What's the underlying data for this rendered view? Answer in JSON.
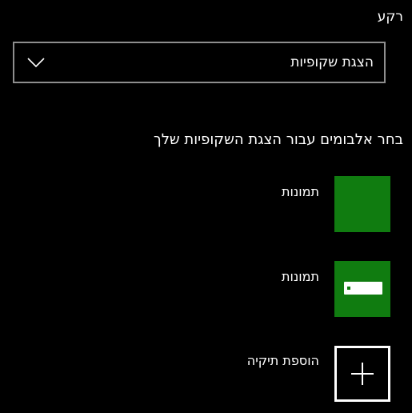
{
  "background": {
    "label": "רקע",
    "dropdown": {
      "selected": "הצגת שקופיות",
      "chevron_icon": "chevron-down-icon"
    }
  },
  "slideshow": {
    "heading": "בחר אלבומים עבור הצגת השקופיות שלך",
    "albums": [
      {
        "title": "תמונות",
        "tile_color": "#107c10",
        "tile_icon": "none"
      },
      {
        "title": "תמונות",
        "tile_color": "#107c10",
        "tile_icon": "drive-icon"
      }
    ],
    "add_folder": {
      "label": "הוספת תיקיה",
      "icon": "plus-icon"
    }
  },
  "colors": {
    "background": "#000000",
    "text": "#ffffff",
    "dropdown_border": "#8e8e8e",
    "accent": "#107c10"
  }
}
